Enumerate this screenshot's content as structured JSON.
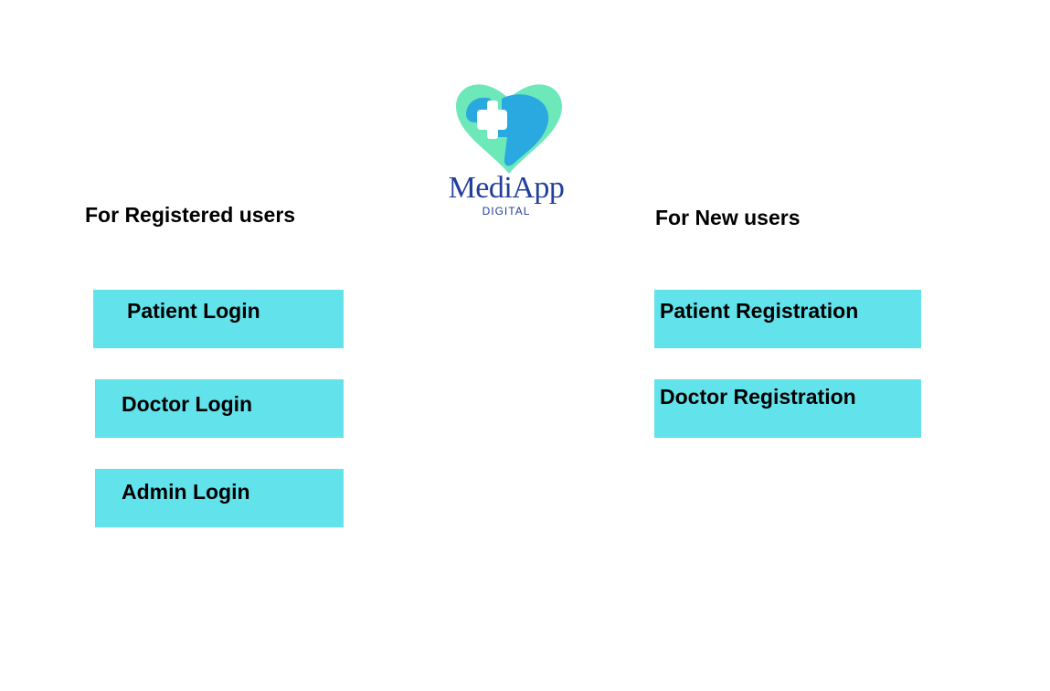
{
  "brand": {
    "name": "MediApp",
    "tagline": "DIGITAL",
    "colors": {
      "heart_back": "#6de8b9",
      "heart_front": "#29a9df",
      "text": "#233f9c"
    }
  },
  "registered_section": {
    "heading": "For Registered users",
    "buttons": [
      {
        "label": "Patient Login"
      },
      {
        "label": "Doctor Login"
      },
      {
        "label": "Admin Login"
      }
    ]
  },
  "new_section": {
    "heading": "For New users",
    "buttons": [
      {
        "label": "Patient Registration"
      },
      {
        "label": "Doctor Registration"
      }
    ]
  },
  "colors": {
    "button_bg": "#62e3ec",
    "background": "#ffffff",
    "text": "#000000"
  }
}
